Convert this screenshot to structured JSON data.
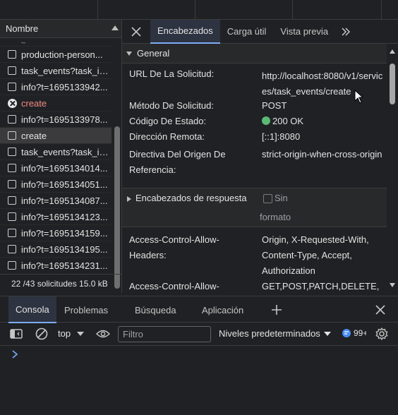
{
  "request_list": {
    "column_header": "Nombre",
    "rows": [
      {
        "label": "production-person...",
        "type": "checkbox"
      },
      {
        "label": "task_events?task_id...",
        "type": "checkbox"
      },
      {
        "label": "info?t=1695133942...",
        "type": "checkbox"
      },
      {
        "label": "create",
        "type": "error"
      },
      {
        "label": "info?t=1695133978...",
        "type": "checkbox"
      },
      {
        "label": "create",
        "type": "checkbox",
        "selected": true
      },
      {
        "label": "task_events?task_id...",
        "type": "checkbox"
      },
      {
        "label": "info?t=1695134014...",
        "type": "checkbox"
      },
      {
        "label": "info?t=1695134051...",
        "type": "checkbox"
      },
      {
        "label": "info?t=1695134087...",
        "type": "checkbox"
      },
      {
        "label": "info?t=1695134123...",
        "type": "checkbox"
      },
      {
        "label": "info?t=1695134159...",
        "type": "checkbox"
      },
      {
        "label": "info?t=1695134195...",
        "type": "checkbox"
      },
      {
        "label": "info?t=1695134231...",
        "type": "checkbox"
      }
    ],
    "status": "22 /43 solicitudes  15.0 kB"
  },
  "detail_tabs": [
    "Encabezados",
    "Carga útil",
    "Vista previa"
  ],
  "general": {
    "title": "General",
    "url_label": "URL De La Solicitud:",
    "url_value": "http://localhost:8080/v1/services/task_events/create",
    "method_label": "Método De Solicitud:",
    "method_value": "POST",
    "status_label": "Código De Estado:",
    "status_value": "200 OK",
    "status_color": "#5bb974",
    "remote_label": "Dirección Remota:",
    "remote_value": "[::1]:8080",
    "policy_label": "Directiva Del Origen De Referencia:",
    "policy_value": "strict-origin-when-cross-origin"
  },
  "response_headers": {
    "title": "Encabezados de respuesta",
    "raw_label_1": "Sin",
    "raw_label_2": "formato",
    "items": [
      {
        "key": "Access-Control-Allow-Headers:",
        "value": "Origin, X-Requested-With, Content-Type, Accept, Authorization"
      },
      {
        "key": "Access-Control-Allow-Methods:",
        "value": "GET,POST,PATCH,DELETE,OPTIONS"
      }
    ]
  },
  "drawer": {
    "tabs": [
      "Consola",
      "Problemas",
      "Búsqueda",
      "Aplicación"
    ],
    "context": "top",
    "filter_placeholder": "Filtro",
    "levels": "Niveles predeterminados",
    "issues_count": "99+"
  },
  "colors": {
    "accent": "#7cacf8",
    "error": "#f28b82",
    "background": "#202124"
  }
}
